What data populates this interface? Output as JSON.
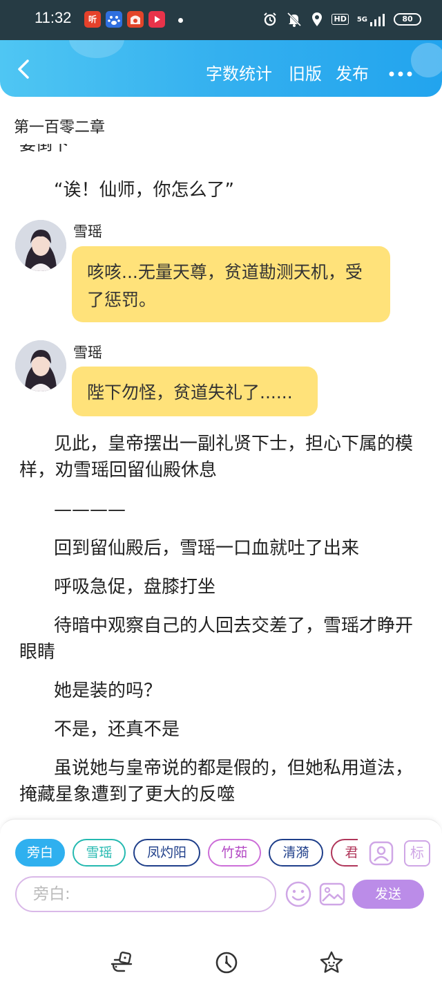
{
  "status_bar": {
    "time": "11:32",
    "app_icons": [
      {
        "name": "ting-app-icon",
        "label": "听",
        "color": "#e5412b"
      },
      {
        "name": "baidu-app-icon",
        "label": "",
        "color": "#2f6fe0"
      },
      {
        "name": "shop-app-icon",
        "label": "",
        "color": "#e3452a"
      },
      {
        "name": "video-app-icon",
        "label": "",
        "color": "#e8334a"
      }
    ],
    "hd_label": "HD",
    "network": "5G",
    "battery": "80"
  },
  "header": {
    "back_icon": "chevron-left-icon",
    "word_count_label": "字数统计",
    "old_version_label": "旧版",
    "publish_label": "发布",
    "more_icon": "more-dots-icon",
    "background_color": "#34b0ef"
  },
  "chapter": {
    "title": "第一百零二章",
    "cut_line": "要倒下"
  },
  "content": {
    "para_dialog_1": "“诶！仙师，你怎么了”",
    "messages": [
      {
        "speaker": "雪瑶",
        "text": "咳咳...无量天尊，贫道勘测天机，受了惩罚。"
      },
      {
        "speaker": "雪瑶",
        "text": "陛下勿怪，贫道失礼了......"
      }
    ],
    "bubble_color": "#ffe27a",
    "paragraphs": [
      "见此，皇帝摆出一副礼贤下士，担心下属的模样，劝雪瑶回留仙殿休息",
      "————",
      "回到留仙殿后，雪瑶一口血就吐了出来",
      "呼吸急促，盘膝打坐",
      "待暗中观察自己的人回去交差了，雪瑶才睁开眼睛",
      "她是装的吗？",
      "不是，还真不是",
      "虽说她与皇帝说的都是假的，但她私用道法，掩藏星象遭到了更大的反噬"
    ]
  },
  "composer": {
    "characters": [
      {
        "label": "旁白",
        "selected": true
      },
      {
        "label": "雪瑶",
        "selected": false
      },
      {
        "label": "凤灼阳",
        "selected": false
      },
      {
        "label": "竹茹",
        "selected": false
      },
      {
        "label": "清漪",
        "selected": false
      },
      {
        "label": "君",
        "selected": false
      }
    ],
    "input_placeholder": "旁白:",
    "send_label": "发送",
    "role_icon": "person-card-icon",
    "tag_label": "标",
    "emoji_icon": "emoji-icon",
    "image_icon": "image-icon",
    "send_color": "#bb8ce8"
  },
  "bottom_nav": {
    "items": [
      "dice-icon",
      "clock-icon",
      "star-face-icon"
    ]
  }
}
